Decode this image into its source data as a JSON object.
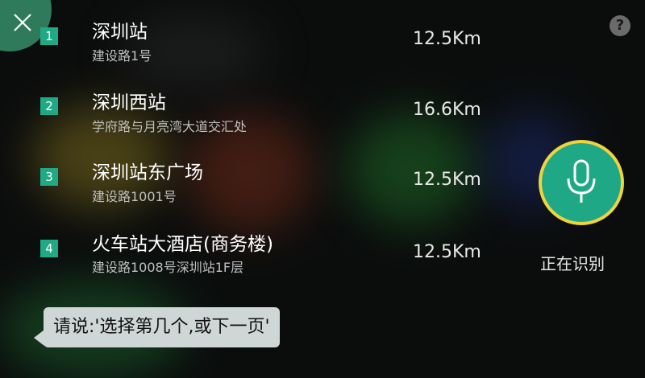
{
  "results": [
    {
      "index": "1",
      "name": "深圳站",
      "address": "建设路1号",
      "distance": "12.5Km"
    },
    {
      "index": "2",
      "name": "深圳西站",
      "address": "学府路与月亮湾大道交汇处",
      "distance": "16.6Km"
    },
    {
      "index": "3",
      "name": "深圳站东广场",
      "address": "建设路1001号",
      "distance": "12.5Km"
    },
    {
      "index": "4",
      "name": "火车站大酒店(商务楼)",
      "address": "建设路1008号深圳站1F层",
      "distance": "12.5Km"
    }
  ],
  "help_glyph": "?",
  "voice": {
    "status": "正在识别",
    "prompt": "请说:'选择第几个,或下一页'"
  },
  "colors": {
    "accent": "#1faa85",
    "mic_ring": "#f1d33a",
    "prompt_bg": "#cfd6d6"
  },
  "icons": {
    "close": "close-icon",
    "help": "help-icon",
    "mic": "microphone-icon"
  }
}
